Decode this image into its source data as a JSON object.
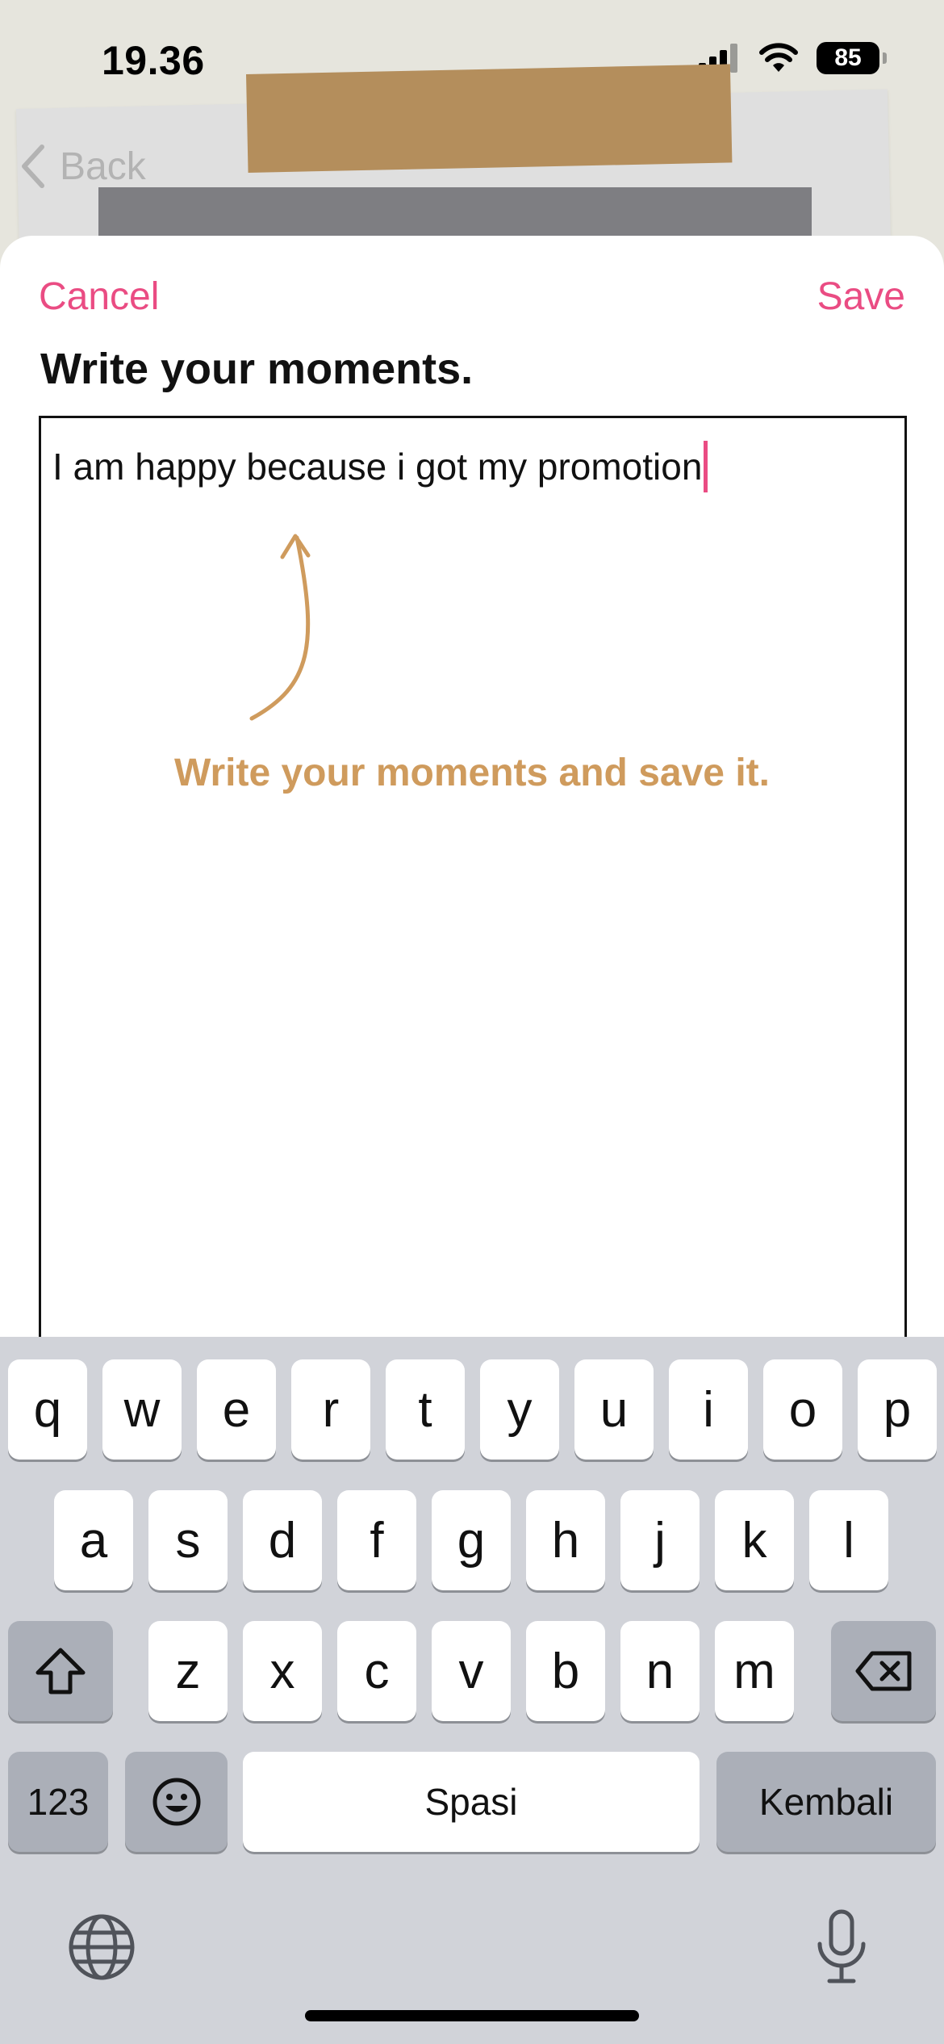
{
  "status": {
    "time": "19.36",
    "battery": "85"
  },
  "background": {
    "back_label": "Back"
  },
  "sheet": {
    "cancel_label": "Cancel",
    "save_label": "Save",
    "title": "Write your moments."
  },
  "editor": {
    "text": "I am happy because i got my promotion"
  },
  "hint": {
    "text": "Write your moments and save it."
  },
  "keyboard": {
    "row1": [
      "q",
      "w",
      "e",
      "r",
      "t",
      "y",
      "u",
      "i",
      "o",
      "p"
    ],
    "row2": [
      "a",
      "s",
      "d",
      "f",
      "g",
      "h",
      "j",
      "k",
      "l"
    ],
    "row3": [
      "z",
      "x",
      "c",
      "v",
      "b",
      "n",
      "m"
    ],
    "numbers_label": "123",
    "space_label": "Spasi",
    "return_label": "Kembali",
    "icons": [
      "shift-icon",
      "backspace-icon",
      "emoji-icon",
      "globe-icon",
      "microphone-icon"
    ]
  },
  "colors": {
    "accent": "#ea4c83",
    "hint": "#cf9b5d",
    "tape": "#b48e5c"
  }
}
